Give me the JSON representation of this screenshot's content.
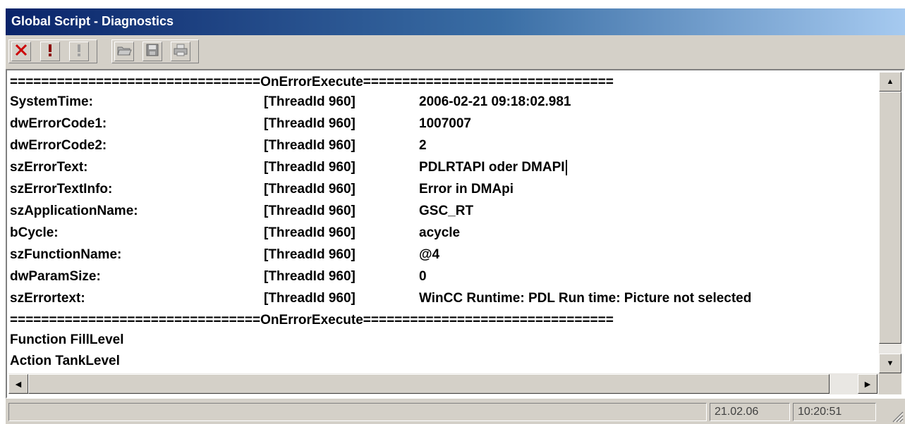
{
  "window": {
    "title": "Global Script - Diagnostics"
  },
  "toolbar": {
    "delete_icon": "✕",
    "priority_high_icon": "!",
    "priority_low_icon": "!",
    "open_icon": "open-folder",
    "save_icon": "save-disk",
    "print_icon": "printer"
  },
  "log": {
    "separator_top": "================================OnErrorExecute================================",
    "entries": [
      {
        "key": "SystemTime:",
        "thread": "[ThreadId 960]",
        "value": "2006-02-21 09:18:02.981"
      },
      {
        "key": "dwErrorCode1:",
        "thread": "[ThreadId 960]",
        "value": "1007007"
      },
      {
        "key": "dwErrorCode2:",
        "thread": "[ThreadId 960]",
        "value": "2"
      },
      {
        "key": "szErrorText:",
        "thread": "[ThreadId 960]",
        "value": "PDLRTAPI oder DMAPI"
      },
      {
        "key": "szErrorTextInfo:",
        "thread": "[ThreadId 960]",
        "value": "Error in DMApi"
      },
      {
        "key": "szApplicationName:",
        "thread": "[ThreadId 960]",
        "value": "GSC_RT"
      },
      {
        "key": "bCycle:",
        "thread": "[ThreadId 960]",
        "value": "acycle"
      },
      {
        "key": "szFunctionName:",
        "thread": "[ThreadId 960]",
        "value": "@4"
      },
      {
        "key": "dwParamSize:",
        "thread": "[ThreadId 960]",
        "value": "0"
      },
      {
        "key": "szErrortext:",
        "thread": "[ThreadId 960]",
        "value": "WinCC Runtime: PDL Run time: Picture not selected"
      }
    ],
    "separator_bottom": "================================OnErrorExecute================================",
    "trailer": [
      "Function FillLevel",
      "Action TankLevel"
    ]
  },
  "statusbar": {
    "date": "21.02.06",
    "time": "10:20:51"
  },
  "colors": {
    "title_start": "#0a246a",
    "title_end": "#a6caf0",
    "face": "#d4d0c8",
    "delete_red": "#cc0000"
  }
}
